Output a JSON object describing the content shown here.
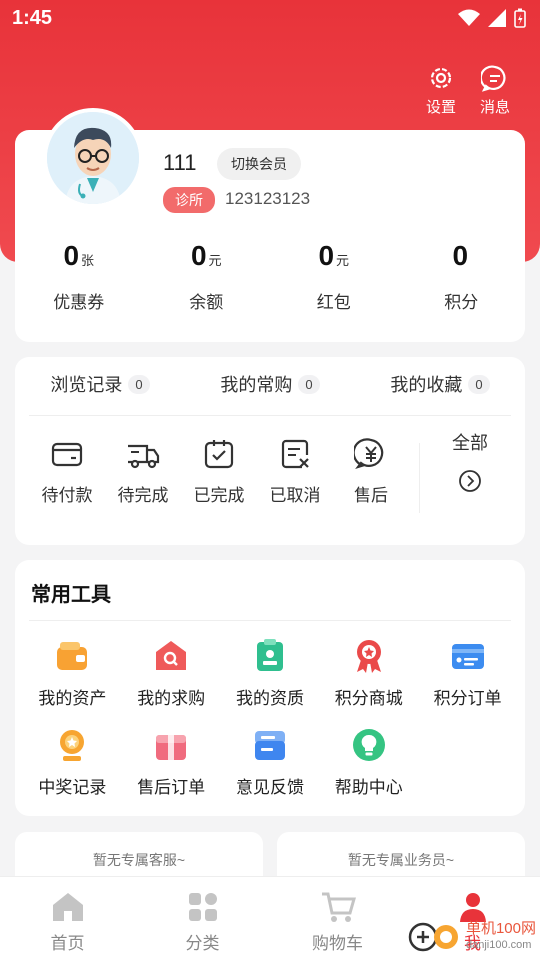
{
  "status_bar": {
    "time": "1:45"
  },
  "header_actions": {
    "settings_label": "设置",
    "messages_label": "消息"
  },
  "profile": {
    "name": "111",
    "switch_label": "切换会员",
    "tag": "诊所",
    "id": "123123123"
  },
  "stats": [
    {
      "value": "0",
      "unit": "张",
      "label": "优惠券"
    },
    {
      "value": "0",
      "unit": "元",
      "label": "余额"
    },
    {
      "value": "0",
      "unit": "元",
      "label": "红包"
    },
    {
      "value": "0",
      "unit": "",
      "label": "积分"
    }
  ],
  "history_tabs": [
    {
      "label": "浏览记录",
      "count": "0"
    },
    {
      "label": "我的常购",
      "count": "0"
    },
    {
      "label": "我的收藏",
      "count": "0"
    }
  ],
  "orders": {
    "items": [
      {
        "label": "待付款",
        "icon": "wallet-icon"
      },
      {
        "label": "待完成",
        "icon": "truck-icon"
      },
      {
        "label": "已完成",
        "icon": "clipboard-check-icon"
      },
      {
        "label": "已取消",
        "icon": "document-cancel-icon"
      },
      {
        "label": "售后",
        "icon": "yuan-chat-icon"
      }
    ],
    "all_label": "全部"
  },
  "tools": {
    "title": "常用工具",
    "items": [
      {
        "label": "我的资产",
        "icon": "wallet-icon",
        "color": "#f8a233"
      },
      {
        "label": "我的求购",
        "icon": "search-house-icon",
        "color": "#ef5a5a"
      },
      {
        "label": "我的资质",
        "icon": "certificate-icon",
        "color": "#2fbf8f"
      },
      {
        "label": "积分商城",
        "icon": "medal-icon",
        "color": "#ea4a4a"
      },
      {
        "label": "积分订单",
        "icon": "card-icon",
        "color": "#3c8cf0"
      },
      {
        "label": "中奖记录",
        "icon": "prize-icon",
        "color": "#f7a531"
      },
      {
        "label": "售后订单",
        "icon": "gift-box-icon",
        "color": "#f06b7e"
      },
      {
        "label": "意见反馈",
        "icon": "feedback-icon",
        "color": "#3f86ef"
      },
      {
        "label": "帮助中心",
        "icon": "lightbulb-icon",
        "color": "#35c482"
      }
    ]
  },
  "service": {
    "left": "暂无专属客服~",
    "right": "暂无专属业务员~"
  },
  "nav": [
    {
      "label": "首页",
      "icon": "home-icon"
    },
    {
      "label": "分类",
      "icon": "category-icon"
    },
    {
      "label": "购物车",
      "icon": "cart-icon"
    },
    {
      "label": "我",
      "icon": "user-icon"
    }
  ],
  "watermark": {
    "line1": "单机100网",
    "line2": "danji100.com"
  },
  "colors": {
    "brand": "#e8333a",
    "tag": "#f26b6b"
  }
}
